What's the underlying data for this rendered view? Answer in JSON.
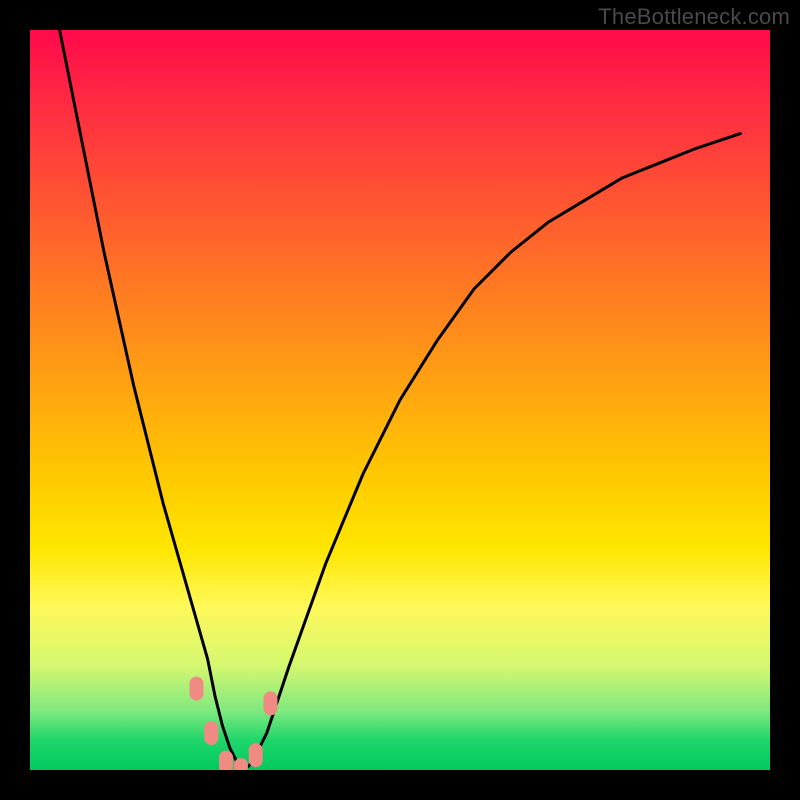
{
  "watermark": {
    "text": "TheBottleneck.com"
  },
  "chart_data": {
    "type": "line",
    "title": "",
    "xlabel": "",
    "ylabel": "",
    "xlim": [
      0,
      100
    ],
    "ylim": [
      0,
      100
    ],
    "series": [
      {
        "name": "bottleneck-curve",
        "x": [
          4,
          6,
          8,
          10,
          12,
          14,
          16,
          18,
          20,
          22,
          24,
          25,
          26,
          27,
          28,
          29,
          30,
          32,
          35,
          40,
          45,
          50,
          55,
          60,
          65,
          70,
          75,
          80,
          85,
          90,
          96
        ],
        "values": [
          100,
          90,
          80,
          70,
          61,
          52,
          44,
          36,
          29,
          22,
          15,
          10,
          6,
          3,
          1,
          0,
          1,
          5,
          14,
          28,
          40,
          50,
          58,
          65,
          70,
          74,
          77,
          80,
          82,
          84,
          86
        ]
      }
    ],
    "markers": {
      "name": "highlight-markers",
      "x": [
        22.5,
        24.5,
        26.5,
        28.5,
        30.5,
        32.5
      ],
      "values": [
        11,
        5,
        1,
        0,
        2,
        9
      ]
    },
    "gradient_stops": [
      {
        "pos": 0,
        "color": "#ff0a4a"
      },
      {
        "pos": 10,
        "color": "#ff2b42"
      },
      {
        "pos": 22,
        "color": "#ff5133"
      },
      {
        "pos": 35,
        "color": "#ff7a22"
      },
      {
        "pos": 48,
        "color": "#ffa311"
      },
      {
        "pos": 60,
        "color": "#ffc800"
      },
      {
        "pos": 70,
        "color": "#ffe600"
      },
      {
        "pos": 78,
        "color": "#fff95a"
      },
      {
        "pos": 86,
        "color": "#d4f770"
      },
      {
        "pos": 92,
        "color": "#7fe97f"
      },
      {
        "pos": 96,
        "color": "#1fd66a"
      },
      {
        "pos": 100,
        "color": "#00c95f"
      }
    ],
    "marker_color": "#f08b84",
    "curve_color": "#000000"
  }
}
